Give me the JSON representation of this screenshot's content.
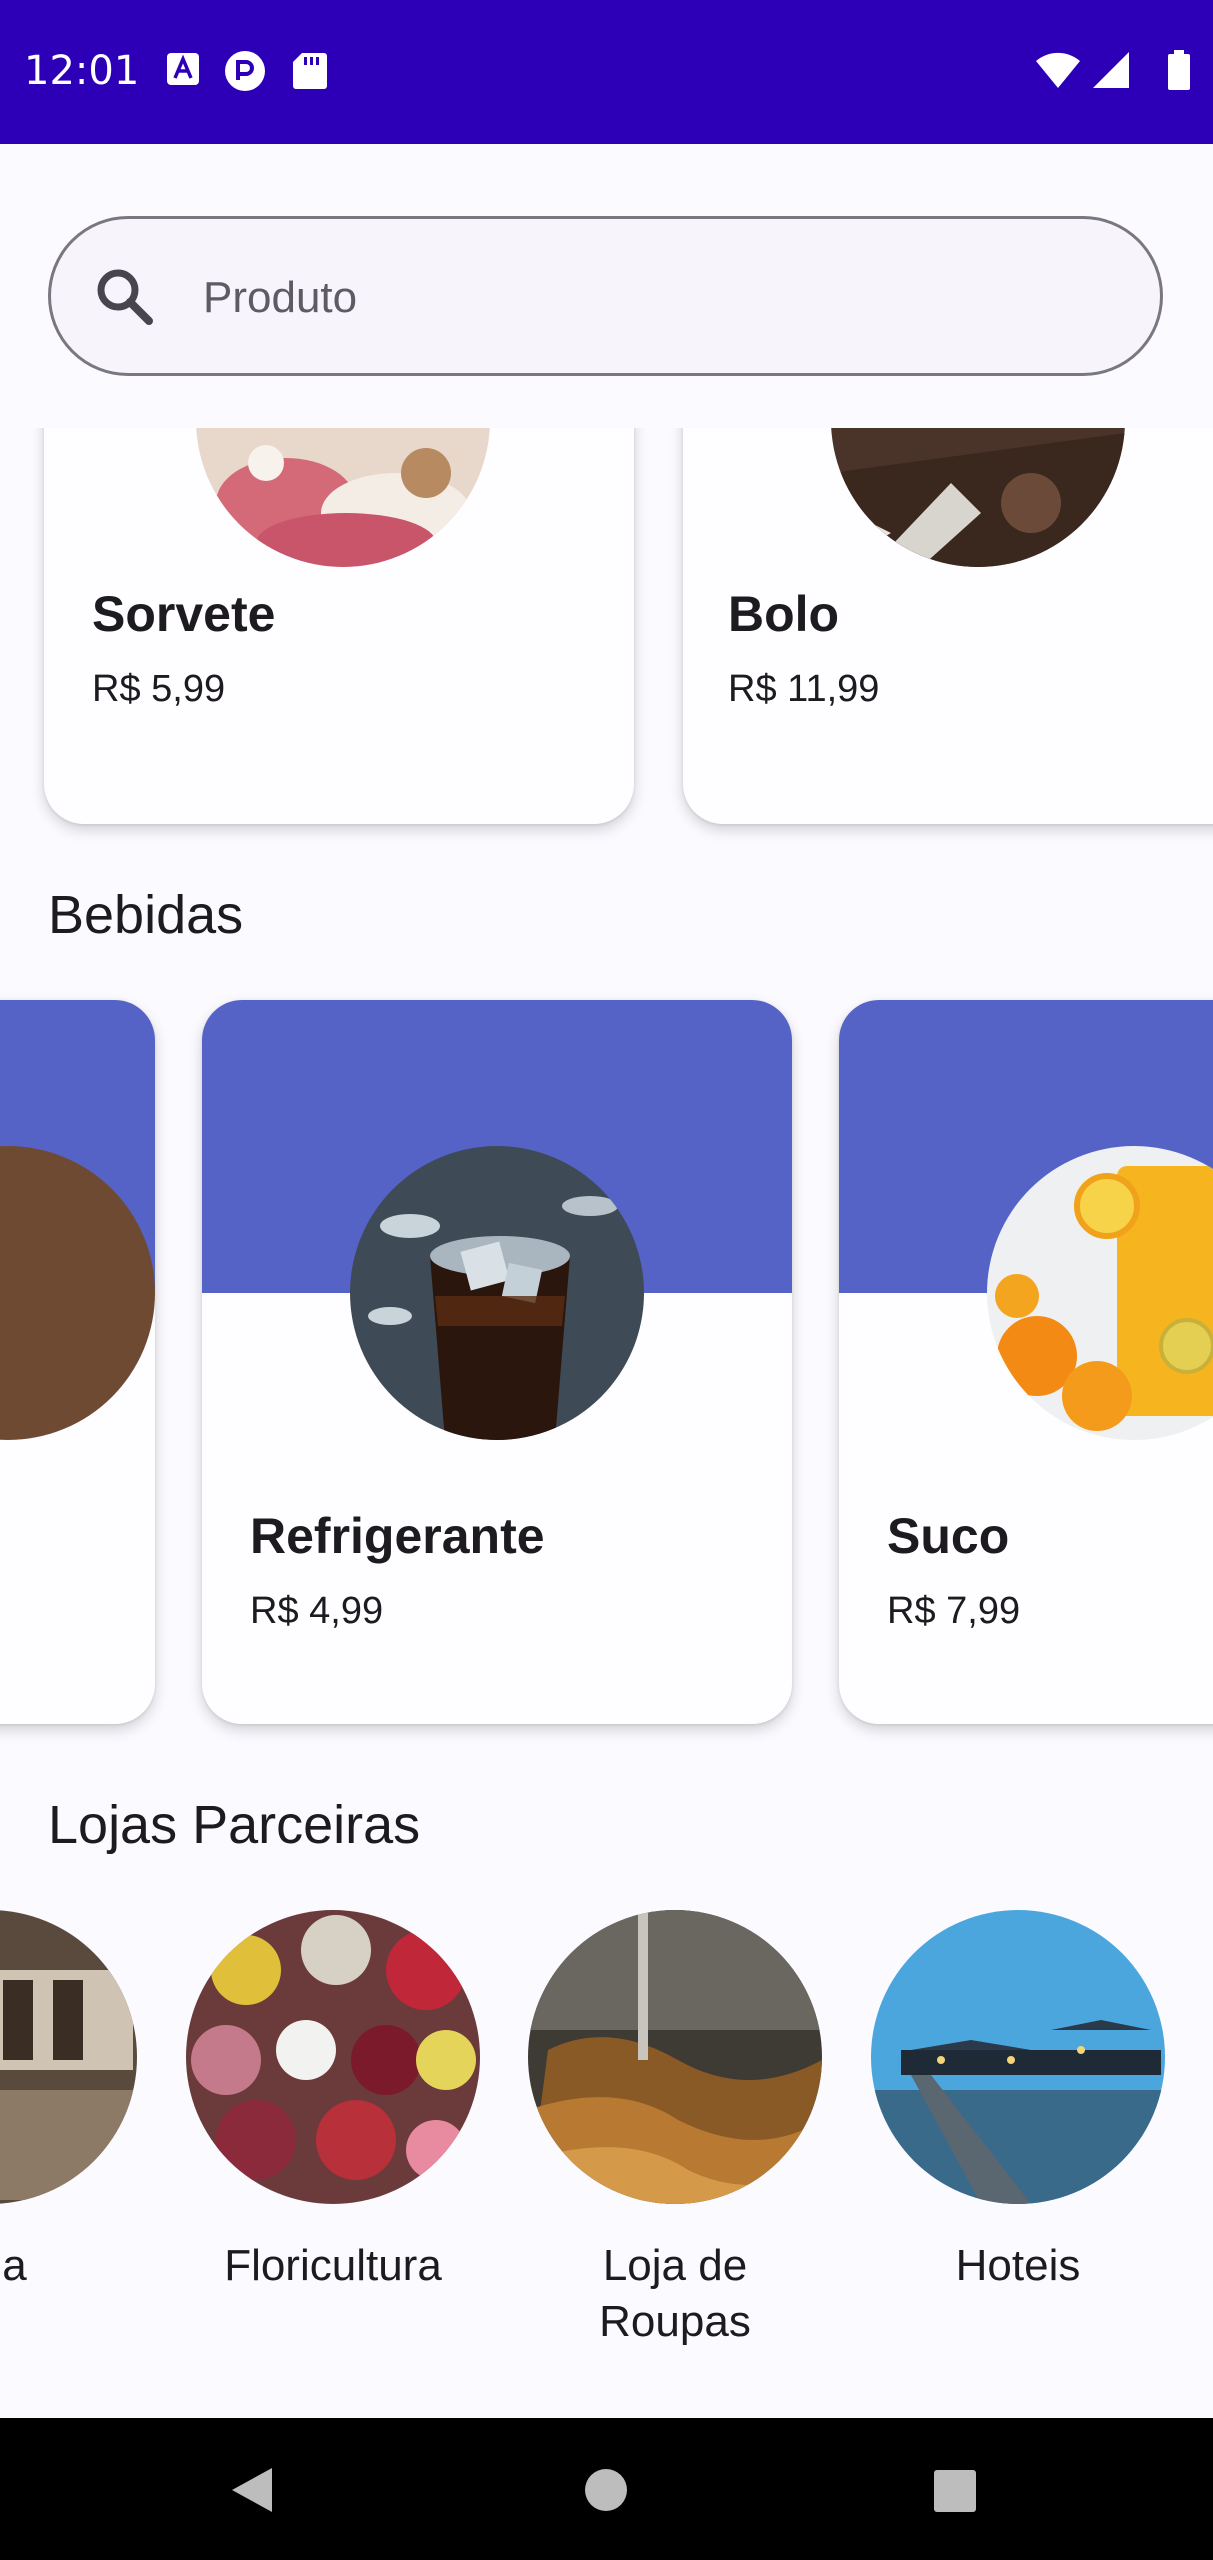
{
  "status_bar": {
    "time": "12:01",
    "left_icons": [
      "a-notification-icon",
      "p-notification-icon",
      "sd-card-icon"
    ],
    "right_icons": [
      "wifi-icon",
      "cellular-signal-icon",
      "battery-icon"
    ],
    "background": "#2d00b8"
  },
  "search": {
    "placeholder": "Produto",
    "value": "",
    "icon": "search-icon"
  },
  "desserts": {
    "items": [
      {
        "name": "Sorvete",
        "price": "R$ 5,99"
      },
      {
        "name": "Bolo",
        "price": "R$ 11,99"
      }
    ]
  },
  "drinks": {
    "title": "Bebidas",
    "banner_color": "#5563c7",
    "items": [
      {
        "name": "Refrigerante",
        "price": "R$ 4,99"
      },
      {
        "name": "Suco",
        "price": "R$ 7,99"
      }
    ]
  },
  "stores": {
    "title": "Lojas Parceiras",
    "items": [
      {
        "label": "aria"
      },
      {
        "label": "Floricultura"
      },
      {
        "label": "Loja de Roupas"
      },
      {
        "label": "Hoteis"
      }
    ]
  },
  "nav_bar": {
    "icons": [
      "back-icon",
      "home-icon",
      "recents-icon"
    ]
  }
}
